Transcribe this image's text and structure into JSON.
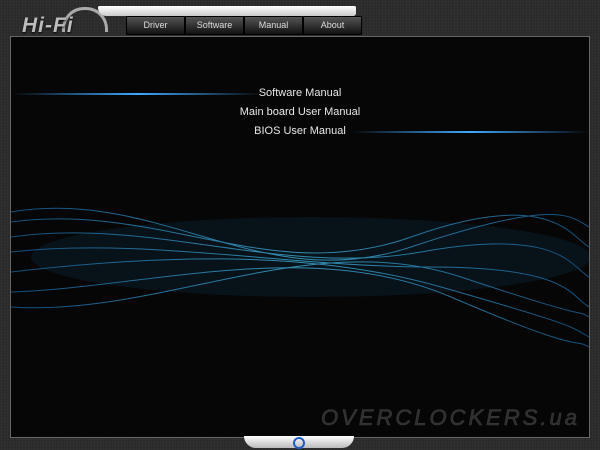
{
  "app": {
    "logo": "Hi-Fi"
  },
  "tabs": [
    {
      "label": "Driver"
    },
    {
      "label": "Software"
    },
    {
      "label": "Manual"
    },
    {
      "label": "About"
    }
  ],
  "manual_menu": [
    {
      "label": "Software Manual"
    },
    {
      "label": "Main board User Manual"
    },
    {
      "label": "BIOS User Manual"
    }
  ],
  "watermark": "OVERCLOCKERS.ua",
  "colors": {
    "accent": "#3fa8ff",
    "power": "#1d5fc0"
  }
}
